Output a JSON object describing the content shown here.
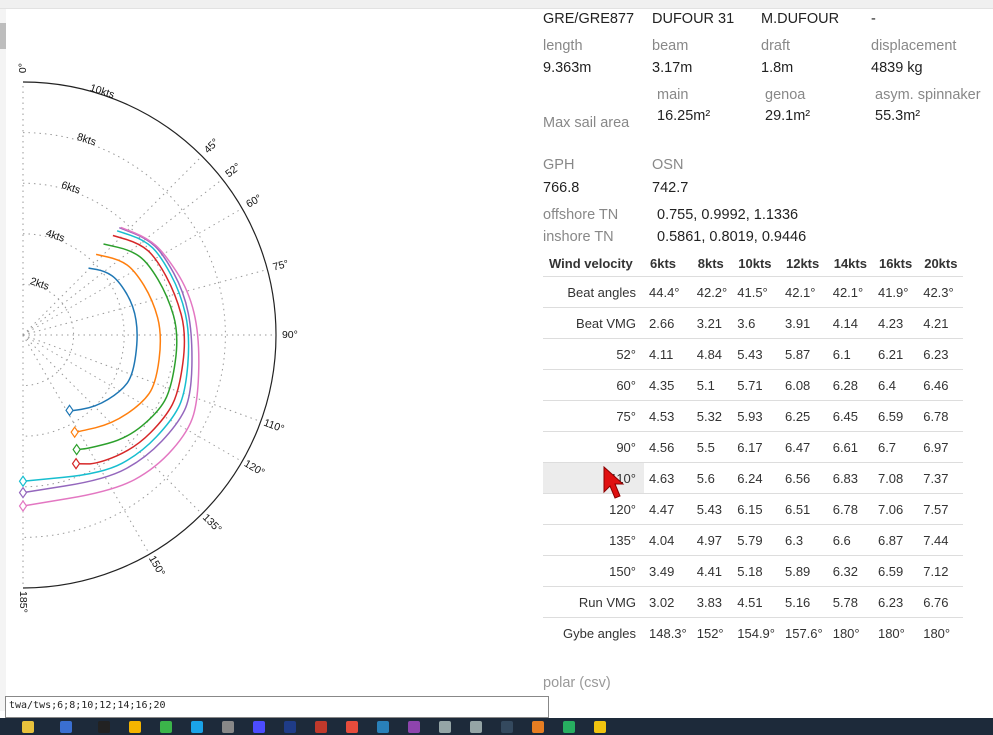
{
  "boat": {
    "sailnumber": "GRE/GRE877",
    "type": "DUFOUR 31",
    "designer": "M.DUFOUR",
    "extra": "-"
  },
  "dimensions": [
    {
      "label": "length",
      "value": "9.363m"
    },
    {
      "label": "beam",
      "value": "3.17m"
    },
    {
      "label": "draft",
      "value": "1.8m"
    },
    {
      "label": "displacement",
      "value": "4839 kg"
    }
  ],
  "sail_area": {
    "label": "Max sail area",
    "items": [
      {
        "label": "main",
        "value": "16.25m²"
      },
      {
        "label": "genoa",
        "value": "29.1m²"
      },
      {
        "label": "spinnaker",
        "value": "asym. spinnaker"
      }
    ],
    "values": [
      "16.25m²",
      "29.1m²",
      "55.3m²"
    ]
  },
  "ratings": {
    "gph_label": "GPH",
    "gph": "766.8",
    "osn_label": "OSN",
    "osn": "742.7"
  },
  "tn": {
    "offshore_label": "offshore TN",
    "offshore": "0.755, 0.9992, 1.1336",
    "inshore_label": "inshore TN",
    "inshore": "0.5861, 0.8019, 0.9446"
  },
  "table": {
    "headers": [
      "Wind velocity",
      "6kts",
      "8kts",
      "10kts",
      "12kts",
      "14kts",
      "16kts",
      "20kts"
    ],
    "rows": [
      {
        "label": "Beat angles",
        "values": [
          "44.4°",
          "42.2°",
          "41.5°",
          "42.1°",
          "42.1°",
          "41.9°",
          "42.3°"
        ]
      },
      {
        "label": "Beat VMG",
        "values": [
          "2.66",
          "3.21",
          "3.6",
          "3.91",
          "4.14",
          "4.23",
          "4.21"
        ]
      },
      {
        "label": "52°",
        "values": [
          "4.11",
          "4.84",
          "5.43",
          "5.87",
          "6.1",
          "6.21",
          "6.23"
        ]
      },
      {
        "label": "60°",
        "values": [
          "4.35",
          "5.1",
          "5.71",
          "6.08",
          "6.28",
          "6.4",
          "6.46"
        ]
      },
      {
        "label": "75°",
        "values": [
          "4.53",
          "5.32",
          "5.93",
          "6.25",
          "6.45",
          "6.59",
          "6.78"
        ]
      },
      {
        "label": "90°",
        "values": [
          "4.56",
          "5.5",
          "6.17",
          "6.47",
          "6.61",
          "6.7",
          "6.97"
        ]
      },
      {
        "label": "110°",
        "values": [
          "4.63",
          "5.6",
          "6.24",
          "6.56",
          "6.83",
          "7.08",
          "7.37"
        ]
      },
      {
        "label": "120°",
        "values": [
          "4.47",
          "5.43",
          "6.15",
          "6.51",
          "6.78",
          "7.06",
          "7.57"
        ]
      },
      {
        "label": "135°",
        "values": [
          "4.04",
          "4.97",
          "5.79",
          "6.3",
          "6.6",
          "6.87",
          "7.44"
        ]
      },
      {
        "label": "150°",
        "values": [
          "3.49",
          "4.41",
          "5.18",
          "5.89",
          "6.32",
          "6.59",
          "7.12"
        ]
      },
      {
        "label": "Run VMG",
        "values": [
          "3.02",
          "3.83",
          "4.51",
          "5.16",
          "5.78",
          "6.23",
          "6.76"
        ]
      },
      {
        "label": "Gybe angles",
        "values": [
          "148.3°",
          "152°",
          "154.9°",
          "157.6°",
          "180°",
          "180°",
          "180°"
        ]
      }
    ]
  },
  "csv_link": "polar (csv)",
  "console_text": "twa/tws;6;8;10;12;14;16;20",
  "chart_data": {
    "type": "line",
    "polar": true,
    "angle_ticks": [
      "0°",
      "45°",
      "52°",
      "60°",
      "75°",
      "90°",
      "110°",
      "120°",
      "135°",
      "150°",
      "185°"
    ],
    "radial_ticks": [
      "2kts",
      "4kts",
      "6kts",
      "8kts",
      "10kts"
    ],
    "radial_max": 10,
    "angles": [
      41.5,
      52,
      60,
      75,
      90,
      110,
      120,
      135,
      150,
      155
    ],
    "series": [
      {
        "name": "6kts",
        "color": "#1f77b4",
        "beat_angle": 44.4,
        "beat_speed": 3.7,
        "values": [
          4.11,
          4.35,
          4.53,
          4.56,
          4.63,
          4.47,
          4.04,
          3.49
        ],
        "gybe_angle": 148.3,
        "gybe_speed": 3.5
      },
      {
        "name": "8kts",
        "color": "#ff7f0e",
        "beat_angle": 42.2,
        "beat_speed": 4.3,
        "values": [
          4.84,
          5.1,
          5.32,
          5.5,
          5.6,
          5.43,
          4.97,
          4.41
        ],
        "gybe_angle": 152,
        "gybe_speed": 4.35
      },
      {
        "name": "10kts",
        "color": "#2ca02c",
        "beat_angle": 41.5,
        "beat_speed": 4.8,
        "values": [
          5.43,
          5.71,
          5.93,
          6.17,
          6.24,
          6.15,
          5.79,
          5.18
        ],
        "gybe_angle": 154.9,
        "gybe_speed": 5.0
      },
      {
        "name": "12kts",
        "color": "#d62728",
        "beat_angle": 42.1,
        "beat_speed": 5.3,
        "values": [
          5.87,
          6.08,
          6.25,
          6.47,
          6.56,
          6.51,
          6.3,
          5.89
        ],
        "gybe_angle": 157.6,
        "gybe_speed": 5.5
      },
      {
        "name": "14kts",
        "color": "#17becf",
        "beat_angle": 42.1,
        "beat_speed": 5.55,
        "values": [
          6.1,
          6.28,
          6.45,
          6.61,
          6.83,
          6.78,
          6.6,
          6.32
        ],
        "gybe_angle": 180,
        "gybe_speed": 5.78
      },
      {
        "name": "16kts",
        "color": "#9467bd",
        "beat_angle": 41.9,
        "beat_speed": 5.7,
        "values": [
          6.21,
          6.4,
          6.59,
          6.7,
          7.08,
          7.06,
          6.87,
          6.59
        ],
        "gybe_angle": 180,
        "gybe_speed": 6.23
      },
      {
        "name": "20kts",
        "color": "#e377c2",
        "beat_angle": 42.3,
        "beat_speed": 5.75,
        "values": [
          6.23,
          6.46,
          6.78,
          6.97,
          7.37,
          7.57,
          7.44,
          7.12
        ],
        "gybe_angle": 180,
        "gybe_speed": 6.76
      }
    ]
  }
}
